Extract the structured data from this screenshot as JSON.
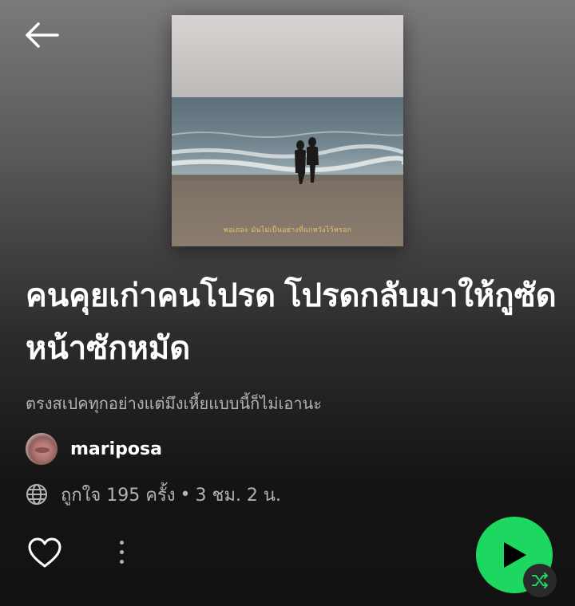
{
  "header": {
    "back_icon": "arrow-left-icon"
  },
  "playlist": {
    "cover_caption": "พอเถอะ มันไม่เป็นอย่างที่แกหวังไว้หรอก",
    "title": "คนคุยเก่าคนโปรด โปรดกลับมาให้กูซัดหน้าซักหมัด",
    "description": "ตรงสเปคทุกอย่างแต่มึงเหี้ยแบบนี้ก็ไม่เอานะ",
    "owner_name": "mariposa",
    "likes": "ถูกใจ 195 ครั้ง",
    "separator": "•",
    "duration": "3 ชม. 2 น."
  },
  "actions": {
    "like_icon": "heart-outline-icon",
    "more_icon": "more-vertical-icon",
    "play_icon": "play-icon",
    "shuffle_icon": "shuffle-icon"
  },
  "colors": {
    "accent": "#1ed760",
    "text_secondary": "#b3b3b3",
    "caption": "#e6c46a"
  }
}
